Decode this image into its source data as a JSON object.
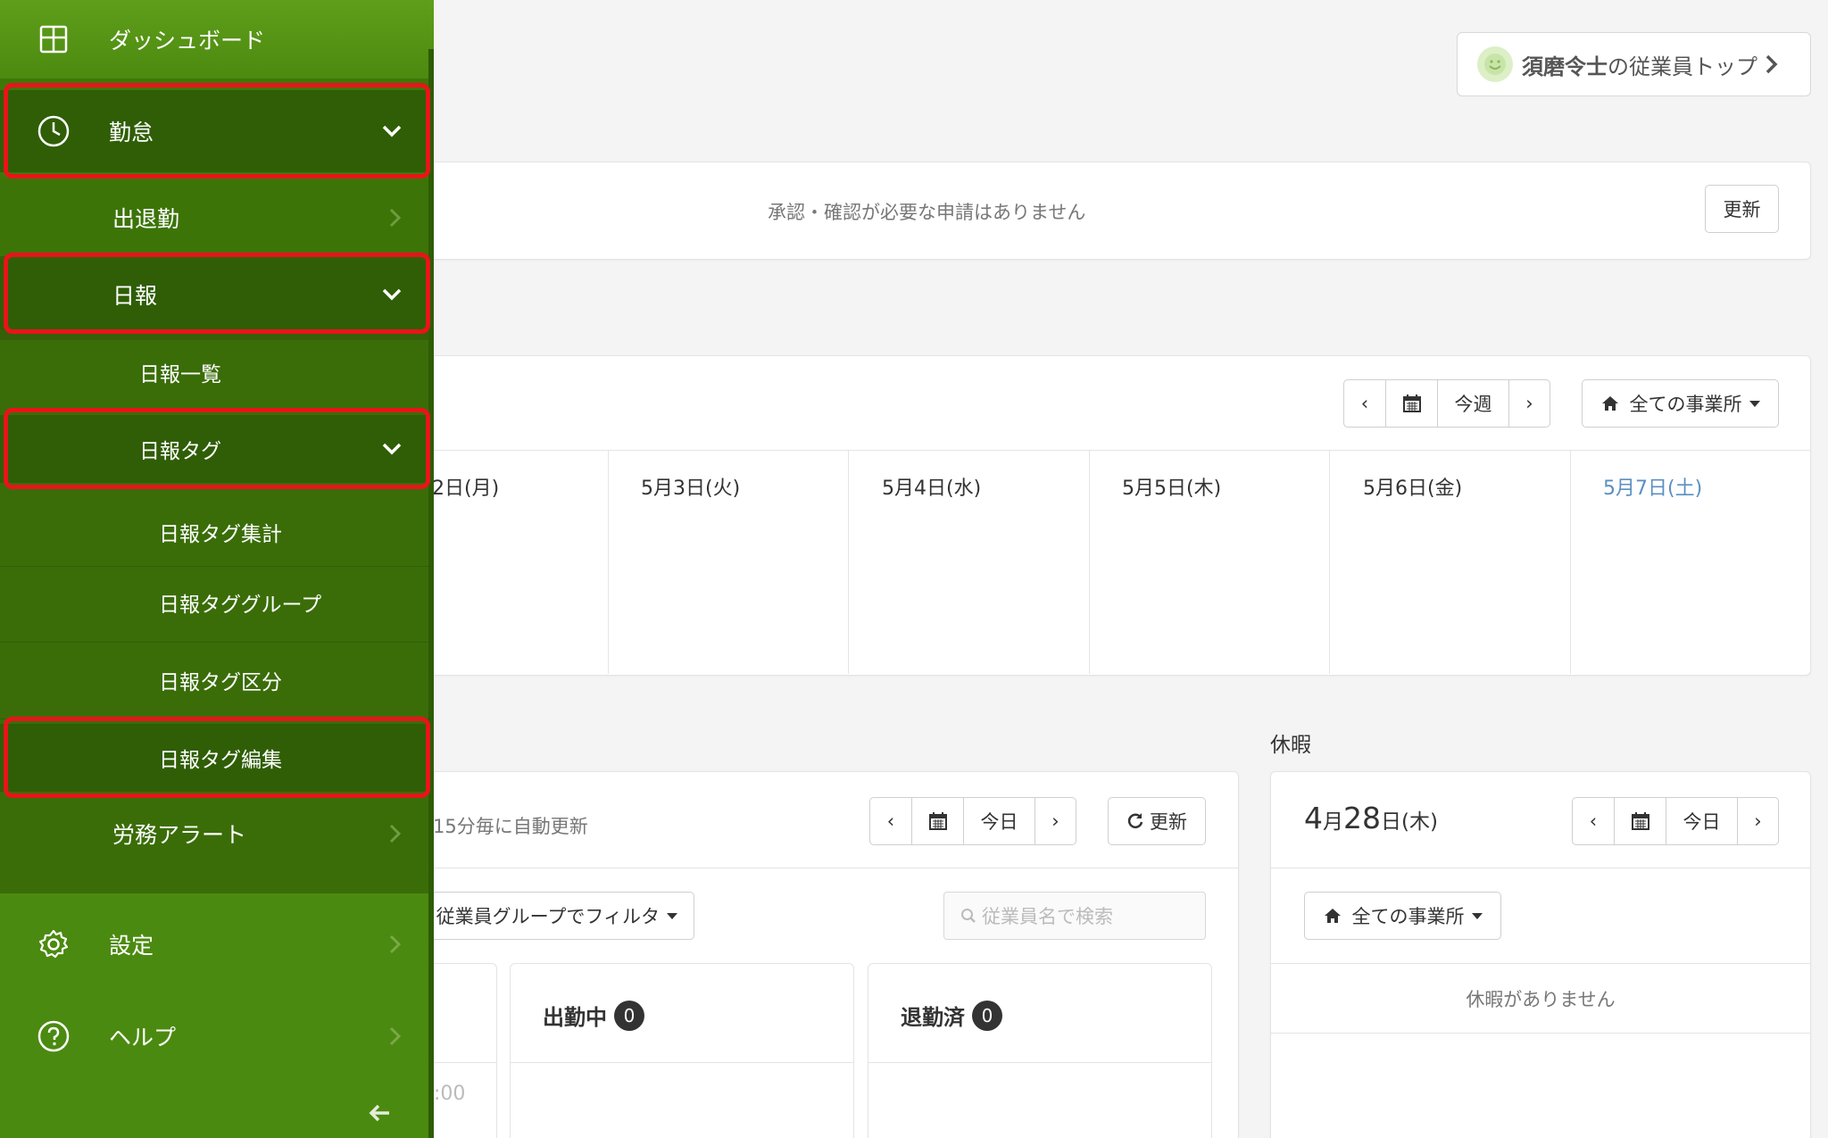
{
  "header": {
    "employee_name": "須磨令士",
    "employee_suffix": "の従業員トップ"
  },
  "approval": {
    "message": "承認・確認が必要な申請はありません",
    "refresh_label": "更新"
  },
  "week": {
    "prev": "‹",
    "this_week": "今週",
    "next": "›",
    "office_filter": "全ての事業所",
    "days": [
      "2日(月)",
      "5月3日(火)",
      "5月4日(水)",
      "5月5日(木)",
      "5月6日(金)",
      "5月7日(土)"
    ],
    "saturday_color": "#5b8fc2"
  },
  "attendance": {
    "auto_refresh": "15分毎に自動更新",
    "prev": "‹",
    "today": "今日",
    "next": "›",
    "refresh_label": "更新",
    "group_filter": "従業員グループでフィルタ",
    "search_placeholder": "従業員名で検索",
    "time_fragment": ":00",
    "working_label": "出勤中",
    "working_count": "0",
    "left_label": "退勤済",
    "left_count": "0"
  },
  "vacation": {
    "section_title": "休暇",
    "date_month": "4",
    "date_month_suffix": "月",
    "date_day": "28",
    "date_day_suffix": "日",
    "date_weekday": "(木)",
    "prev": "‹",
    "today": "今日",
    "next": "›",
    "office_filter": "全ての事業所",
    "empty_message": "休暇がありません"
  },
  "sidebar": {
    "dashboard": "ダッシュボード",
    "attendance": "勤怠",
    "clock_in_out": "出退勤",
    "daily_report": "日報",
    "daily_report_list": "日報一覧",
    "daily_report_tags": "日報タグ",
    "tag_summary": "日報タグ集計",
    "tag_group": "日報タググループ",
    "tag_category": "日報タグ区分",
    "tag_edit": "日報タグ編集",
    "labor_alert": "労務アラート",
    "settings": "設定",
    "help": "ヘルプ",
    "colors": {
      "bg": "#3f7a0a",
      "active": "#2f5e06",
      "highlight": "#e8141a"
    }
  }
}
